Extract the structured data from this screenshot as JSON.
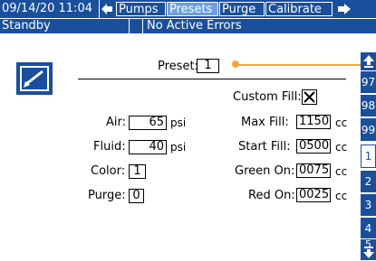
{
  "header": {
    "datetime": "09/14/20 11:04",
    "back_arrow": "arrow-left-icon",
    "tabs": [
      {
        "label": "Pumps",
        "active": false
      },
      {
        "label": "Presets",
        "active": true
      },
      {
        "label": "Purge",
        "active": false
      },
      {
        "label": "Calibrate",
        "active": false
      }
    ],
    "forward_arrow": "arrow-right-icon"
  },
  "status": {
    "mode": "Standby",
    "errors": "No Active Errors"
  },
  "form": {
    "preset_label": "Preset:",
    "preset_value": "1",
    "custom_fill_label": "Custom Fill:",
    "custom_fill_checked": true,
    "air_label": "Air:",
    "air_value": "65",
    "air_unit": "psi",
    "max_fill_label": "Max Fill:",
    "max_fill_value": "1150",
    "max_fill_unit": "cc",
    "fluid_label": "Fluid:",
    "fluid_value": "40",
    "fluid_unit": "psi",
    "start_fill_label": "Start Fill:",
    "start_fill_value": "0500",
    "start_fill_unit": "cc",
    "color_label": "Color:",
    "color_value": "1",
    "green_on_label": "Green On:",
    "green_on_value": "0075",
    "green_on_unit": "cc",
    "purge_label": "Purge:",
    "purge_value": "0",
    "red_on_label": "Red On:",
    "red_on_value": "0025",
    "red_on_unit": "cc"
  },
  "preset_list": {
    "items": [
      "97",
      "98",
      "99",
      "1",
      "2",
      "3",
      "4",
      "5"
    ],
    "selected": "1"
  },
  "colors": {
    "header_blue": "#1a4f9c",
    "active_tab": "#6e9fe0",
    "indicator_orange": "#f2a93b"
  }
}
